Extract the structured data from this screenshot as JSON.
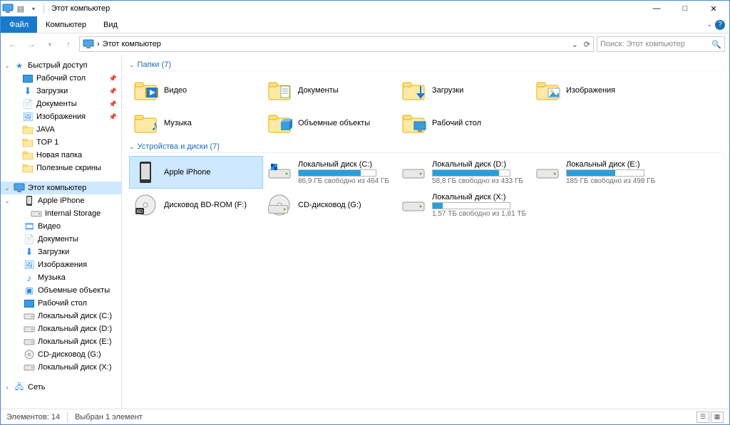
{
  "window": {
    "title": "Этот компьютер",
    "controls": {
      "min": "—",
      "max": "□",
      "close": "✕"
    }
  },
  "ribbon": {
    "file": "Файл",
    "computer": "Компьютер",
    "view": "Вид"
  },
  "nav": {
    "breadcrumb_sep": "›",
    "location": "Этот компьютер",
    "refresh_dropdown": "⌄",
    "search_placeholder": "Поиск: Этот компьютер"
  },
  "tree": {
    "quick": "Быстрый доступ",
    "quick_items": [
      {
        "label": "Рабочий стол",
        "pinned": true,
        "icon": "desktop"
      },
      {
        "label": "Загрузки",
        "pinned": true,
        "icon": "downloads"
      },
      {
        "label": "Документы",
        "pinned": true,
        "icon": "documents"
      },
      {
        "label": "Изображения",
        "pinned": true,
        "icon": "pictures"
      },
      {
        "label": "JAVA",
        "pinned": false,
        "icon": "folder"
      },
      {
        "label": "TOP 1",
        "pinned": false,
        "icon": "folder"
      },
      {
        "label": "Новая папка",
        "pinned": false,
        "icon": "folder"
      },
      {
        "label": "Полезные скрины",
        "pinned": false,
        "icon": "folder"
      }
    ],
    "this_pc": "Этот компьютер",
    "pc_items": [
      {
        "label": "Apple iPhone",
        "icon": "phone",
        "children": [
          {
            "label": "Internal Storage",
            "icon": "drive"
          }
        ]
      },
      {
        "label": "Видео",
        "icon": "videos"
      },
      {
        "label": "Документы",
        "icon": "documents"
      },
      {
        "label": "Загрузки",
        "icon": "downloads"
      },
      {
        "label": "Изображения",
        "icon": "pictures"
      },
      {
        "label": "Музыка",
        "icon": "music"
      },
      {
        "label": "Объемные объекты",
        "icon": "3d"
      },
      {
        "label": "Рабочий стол",
        "icon": "desktop"
      },
      {
        "label": "Локальный диск (C:)",
        "icon": "drive"
      },
      {
        "label": "Локальный диск (D:)",
        "icon": "drive"
      },
      {
        "label": "Локальный диск (E:)",
        "icon": "drive"
      },
      {
        "label": "CD-дисковод (G:)",
        "icon": "cd"
      },
      {
        "label": "Локальный диск (X:)",
        "icon": "drive"
      }
    ],
    "network": "Сеть"
  },
  "content": {
    "folders_header": "Папки (7)",
    "devices_header": "Устройства и диски (7)",
    "folders": [
      {
        "name": "Видео",
        "icon": "videos"
      },
      {
        "name": "Документы",
        "icon": "documents"
      },
      {
        "name": "Загрузки",
        "icon": "downloads"
      },
      {
        "name": "Изображения",
        "icon": "pictures"
      },
      {
        "name": "Музыка",
        "icon": "music"
      },
      {
        "name": "Объемные объекты",
        "icon": "3d"
      },
      {
        "name": "Рабочий стол",
        "icon": "desktop"
      }
    ],
    "devices": [
      {
        "name": "Apple iPhone",
        "sub": "",
        "bar": null,
        "icon": "phone",
        "selected": true
      },
      {
        "name": "Локальный диск (C:)",
        "sub": "86,9 ГБ свободно из 464 ГБ",
        "bar": 0.81,
        "icon": "osdrive"
      },
      {
        "name": "Локальный диск (D:)",
        "sub": "58,8 ГБ свободно из 433 ГБ",
        "bar": 0.86,
        "icon": "drive"
      },
      {
        "name": "Локальный диск (E:)",
        "sub": "185 ГБ свободно из 498 ГБ",
        "bar": 0.63,
        "icon": "drive"
      },
      {
        "name": "Дисковод BD-ROM (F:)",
        "sub": "",
        "bar": null,
        "icon": "bd"
      },
      {
        "name": "CD-дисковод (G:)",
        "sub": "",
        "bar": null,
        "icon": "cd"
      },
      {
        "name": "Локальный диск (X:)",
        "sub": "1,57 ТБ свободно из 1,81 ТБ",
        "bar": 0.13,
        "icon": "drive"
      }
    ]
  },
  "status": {
    "count": "Элементов: 14",
    "selected": "Выбран 1 элемент"
  }
}
